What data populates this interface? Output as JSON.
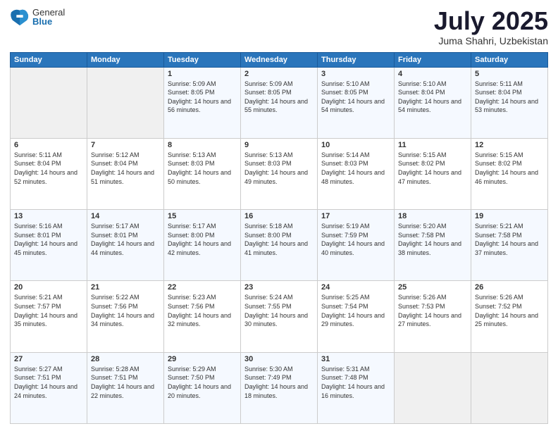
{
  "logo": {
    "general": "General",
    "blue": "Blue"
  },
  "title": "July 2025",
  "subtitle": "Juma Shahri, Uzbekistan",
  "headers": [
    "Sunday",
    "Monday",
    "Tuesday",
    "Wednesday",
    "Thursday",
    "Friday",
    "Saturday"
  ],
  "weeks": [
    [
      {
        "day": "",
        "empty": true
      },
      {
        "day": "",
        "empty": true
      },
      {
        "day": "1",
        "sunrise": "5:09 AM",
        "sunset": "8:05 PM",
        "daylight": "14 hours and 56 minutes"
      },
      {
        "day": "2",
        "sunrise": "5:09 AM",
        "sunset": "8:05 PM",
        "daylight": "14 hours and 55 minutes"
      },
      {
        "day": "3",
        "sunrise": "5:10 AM",
        "sunset": "8:05 PM",
        "daylight": "14 hours and 54 minutes"
      },
      {
        "day": "4",
        "sunrise": "5:10 AM",
        "sunset": "8:04 PM",
        "daylight": "14 hours and 54 minutes"
      },
      {
        "day": "5",
        "sunrise": "5:11 AM",
        "sunset": "8:04 PM",
        "daylight": "14 hours and 53 minutes"
      }
    ],
    [
      {
        "day": "6",
        "sunrise": "5:11 AM",
        "sunset": "8:04 PM",
        "daylight": "14 hours and 52 minutes"
      },
      {
        "day": "7",
        "sunrise": "5:12 AM",
        "sunset": "8:04 PM",
        "daylight": "14 hours and 51 minutes"
      },
      {
        "day": "8",
        "sunrise": "5:13 AM",
        "sunset": "8:03 PM",
        "daylight": "14 hours and 50 minutes"
      },
      {
        "day": "9",
        "sunrise": "5:13 AM",
        "sunset": "8:03 PM",
        "daylight": "14 hours and 49 minutes"
      },
      {
        "day": "10",
        "sunrise": "5:14 AM",
        "sunset": "8:03 PM",
        "daylight": "14 hours and 48 minutes"
      },
      {
        "day": "11",
        "sunrise": "5:15 AM",
        "sunset": "8:02 PM",
        "daylight": "14 hours and 47 minutes"
      },
      {
        "day": "12",
        "sunrise": "5:15 AM",
        "sunset": "8:02 PM",
        "daylight": "14 hours and 46 minutes"
      }
    ],
    [
      {
        "day": "13",
        "sunrise": "5:16 AM",
        "sunset": "8:01 PM",
        "daylight": "14 hours and 45 minutes"
      },
      {
        "day": "14",
        "sunrise": "5:17 AM",
        "sunset": "8:01 PM",
        "daylight": "14 hours and 44 minutes"
      },
      {
        "day": "15",
        "sunrise": "5:17 AM",
        "sunset": "8:00 PM",
        "daylight": "14 hours and 42 minutes"
      },
      {
        "day": "16",
        "sunrise": "5:18 AM",
        "sunset": "8:00 PM",
        "daylight": "14 hours and 41 minutes"
      },
      {
        "day": "17",
        "sunrise": "5:19 AM",
        "sunset": "7:59 PM",
        "daylight": "14 hours and 40 minutes"
      },
      {
        "day": "18",
        "sunrise": "5:20 AM",
        "sunset": "7:58 PM",
        "daylight": "14 hours and 38 minutes"
      },
      {
        "day": "19",
        "sunrise": "5:21 AM",
        "sunset": "7:58 PM",
        "daylight": "14 hours and 37 minutes"
      }
    ],
    [
      {
        "day": "20",
        "sunrise": "5:21 AM",
        "sunset": "7:57 PM",
        "daylight": "14 hours and 35 minutes"
      },
      {
        "day": "21",
        "sunrise": "5:22 AM",
        "sunset": "7:56 PM",
        "daylight": "14 hours and 34 minutes"
      },
      {
        "day": "22",
        "sunrise": "5:23 AM",
        "sunset": "7:56 PM",
        "daylight": "14 hours and 32 minutes"
      },
      {
        "day": "23",
        "sunrise": "5:24 AM",
        "sunset": "7:55 PM",
        "daylight": "14 hours and 30 minutes"
      },
      {
        "day": "24",
        "sunrise": "5:25 AM",
        "sunset": "7:54 PM",
        "daylight": "14 hours and 29 minutes"
      },
      {
        "day": "25",
        "sunrise": "5:26 AM",
        "sunset": "7:53 PM",
        "daylight": "14 hours and 27 minutes"
      },
      {
        "day": "26",
        "sunrise": "5:26 AM",
        "sunset": "7:52 PM",
        "daylight": "14 hours and 25 minutes"
      }
    ],
    [
      {
        "day": "27",
        "sunrise": "5:27 AM",
        "sunset": "7:51 PM",
        "daylight": "14 hours and 24 minutes"
      },
      {
        "day": "28",
        "sunrise": "5:28 AM",
        "sunset": "7:51 PM",
        "daylight": "14 hours and 22 minutes"
      },
      {
        "day": "29",
        "sunrise": "5:29 AM",
        "sunset": "7:50 PM",
        "daylight": "14 hours and 20 minutes"
      },
      {
        "day": "30",
        "sunrise": "5:30 AM",
        "sunset": "7:49 PM",
        "daylight": "14 hours and 18 minutes"
      },
      {
        "day": "31",
        "sunrise": "5:31 AM",
        "sunset": "7:48 PM",
        "daylight": "14 hours and 16 minutes"
      },
      {
        "day": "",
        "empty": true
      },
      {
        "day": "",
        "empty": true
      }
    ]
  ]
}
